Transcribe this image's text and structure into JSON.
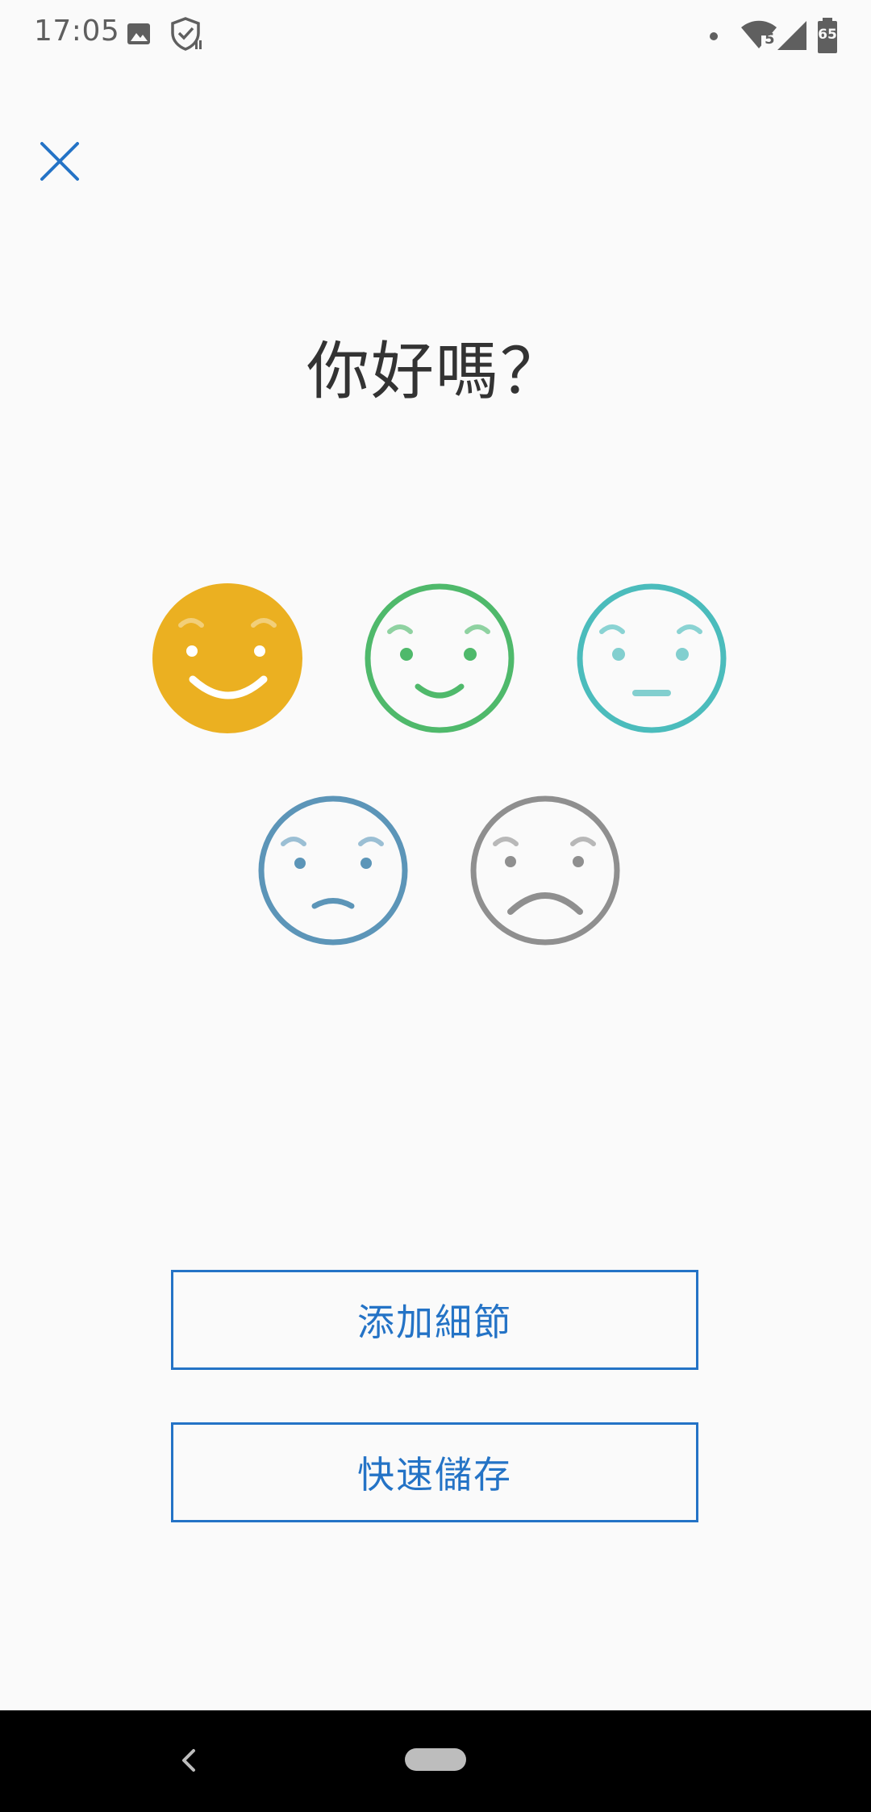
{
  "status_bar": {
    "time": "17:05",
    "icons": [
      "image-icon",
      "shield-check-icon",
      "dot-icon",
      "wifi-icon",
      "signal-icon",
      "battery-icon"
    ],
    "battery_level": "65",
    "wifi_badge": "5"
  },
  "header": {
    "close_icon": "close-icon"
  },
  "main": {
    "title": "你好嗎？",
    "moods": [
      {
        "name": "great",
        "color": "#ebb021",
        "selected": true
      },
      {
        "name": "good",
        "color": "#4fb96b",
        "selected": false
      },
      {
        "name": "neutral",
        "color": "#4bbcbc",
        "selected": false
      },
      {
        "name": "bad",
        "color": "#5c95b8",
        "selected": false
      },
      {
        "name": "awful",
        "color": "#8f8f8f",
        "selected": false
      }
    ]
  },
  "actions": {
    "add_details_label": "添加細節",
    "quick_save_label": "快速儲存"
  },
  "theme": {
    "accent": "#2473c6",
    "background": "#fafafa"
  },
  "nav_bar": {
    "icons": [
      "back-icon",
      "home-pill-icon"
    ]
  }
}
